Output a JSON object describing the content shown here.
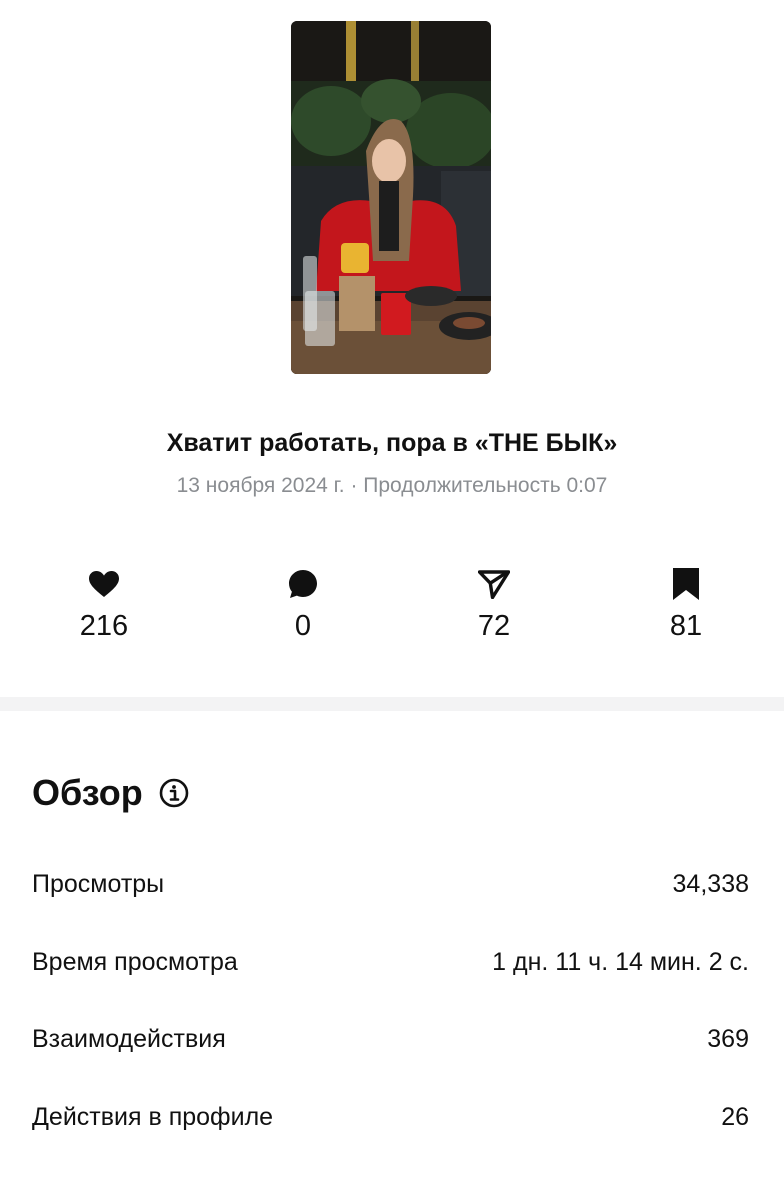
{
  "post": {
    "title": "Хватит работать, пора в «THE БЫК»",
    "meta": "13 ноября 2024 г. · Продолжительность 0:07"
  },
  "stats": [
    {
      "icon": "heart-icon",
      "value": "216"
    },
    {
      "icon": "comment-icon",
      "value": "0"
    },
    {
      "icon": "share-icon",
      "value": "72"
    },
    {
      "icon": "bookmark-icon",
      "value": "81"
    }
  ],
  "overview": {
    "title": "Обзор",
    "icon": "info-icon",
    "rows": [
      {
        "label": "Просмотры",
        "value": "34,338"
      },
      {
        "label": "Время просмотра",
        "value": "1 дн. 11 ч. 14 мин. 2 с."
      },
      {
        "label": "Взаимодействия",
        "value": "369"
      },
      {
        "label": "Действия в профиле",
        "value": "26"
      }
    ]
  },
  "colors": {
    "text": "#111111",
    "secondary_text": "#8a8d91",
    "divider": "#f3f3f4"
  }
}
